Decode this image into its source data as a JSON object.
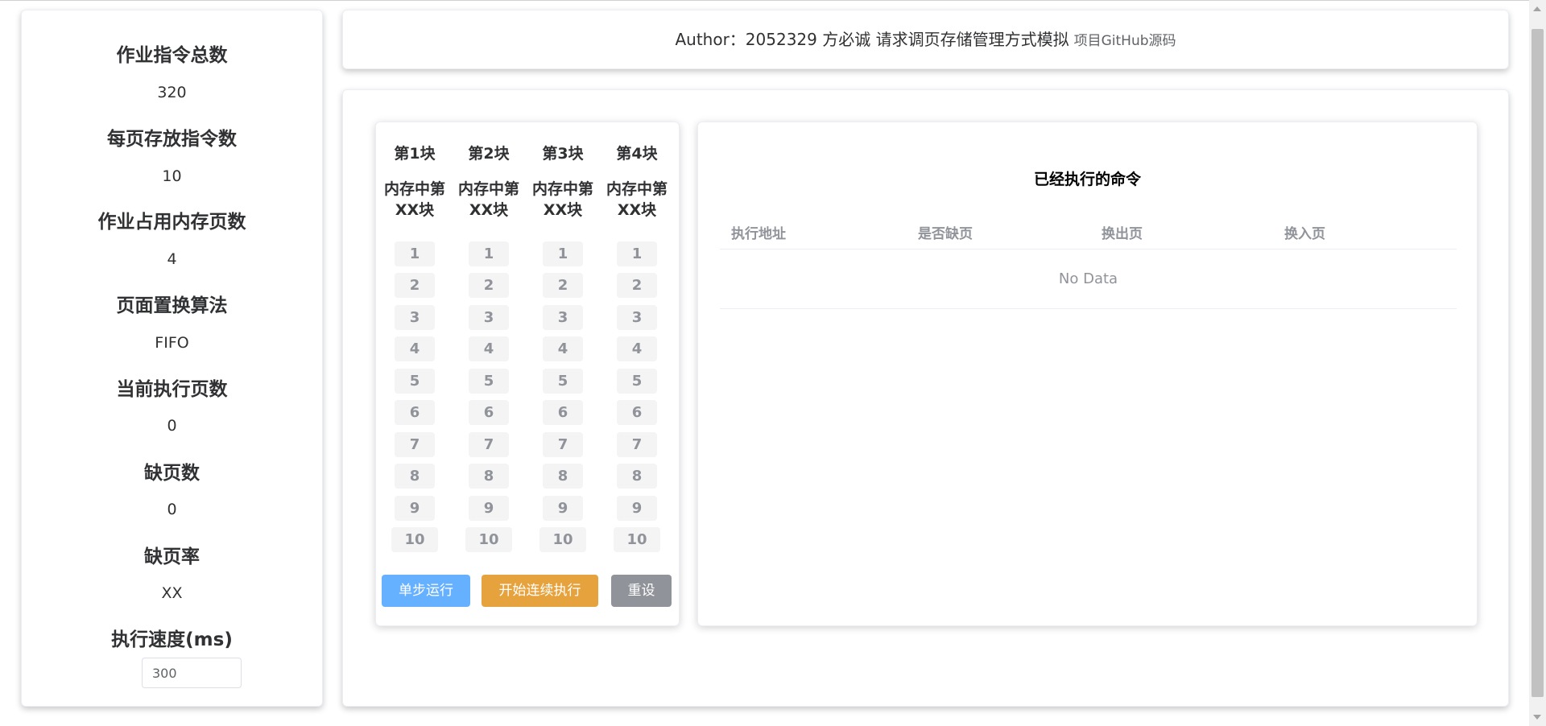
{
  "stats": [
    {
      "title": "作业指令总数",
      "value": "320"
    },
    {
      "title": "每页存放指令数",
      "value": "10"
    },
    {
      "title": "作业占用内存页数",
      "value": "4"
    },
    {
      "title": "页面置换算法",
      "value": "FIFO"
    },
    {
      "title": "当前执行页数",
      "value": "0"
    },
    {
      "title": "缺页数",
      "value": "0"
    },
    {
      "title": "缺页率",
      "value": "XX"
    }
  ],
  "speed": {
    "title": "执行速度(ms)",
    "value": "300"
  },
  "header": {
    "text": "Author：2052329 方必诚 请求调页存储管理方式模拟",
    "link": "项目GitHub源码"
  },
  "memory": {
    "blocks": [
      {
        "title": "第1块",
        "subtitle_line1": "内存中第",
        "subtitle_line2": "XX块"
      },
      {
        "title": "第2块",
        "subtitle_line1": "内存中第",
        "subtitle_line2": "XX块"
      },
      {
        "title": "第3块",
        "subtitle_line1": "内存中第",
        "subtitle_line2": "XX块"
      },
      {
        "title": "第4块",
        "subtitle_line1": "内存中第",
        "subtitle_line2": "XX块"
      }
    ],
    "slots": [
      "1",
      "2",
      "3",
      "4",
      "5",
      "6",
      "7",
      "8",
      "9",
      "10"
    ],
    "buttons": {
      "step": "单步运行",
      "run": "开始连续执行",
      "reset": "重设"
    }
  },
  "executed": {
    "title": "已经执行的命令",
    "columns": [
      "执行地址",
      "是否缺页",
      "换出页",
      "换入页"
    ],
    "empty_text": "No Data"
  },
  "colors": {
    "step_button": "#66b1ff",
    "run_button": "#e6a23c",
    "reset_button": "#909399",
    "slot_bg": "#f4f4f5"
  }
}
